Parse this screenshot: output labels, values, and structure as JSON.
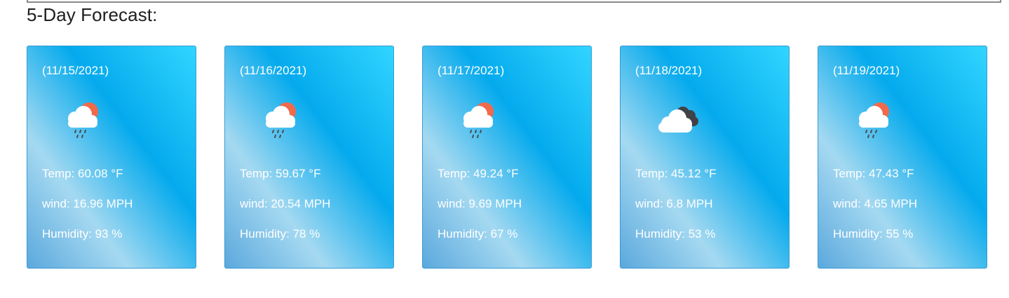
{
  "section_title": "5-Day Forecast:",
  "days": [
    {
      "date": "(11/15/2021)",
      "icon": "rain-cloud-sun-icon",
      "temp": "Temp: 60.08 °F",
      "wind": "wind: 16.96 MPH",
      "humidity": "Humidity: 93 %"
    },
    {
      "date": "(11/16/2021)",
      "icon": "rain-cloud-sun-icon",
      "temp": "Temp: 59.67 °F",
      "wind": "wind: 20.54 MPH",
      "humidity": "Humidity: 78 %"
    },
    {
      "date": "(11/17/2021)",
      "icon": "rain-cloud-sun-icon",
      "temp": "Temp: 49.24 °F",
      "wind": "wind: 9.69 MPH",
      "humidity": "Humidity: 67 %"
    },
    {
      "date": "(11/18/2021)",
      "icon": "broken-clouds-icon",
      "temp": "Temp: 45.12 °F",
      "wind": "wind: 6.8 MPH",
      "humidity": "Humidity: 53 %"
    },
    {
      "date": "(11/19/2021)",
      "icon": "rain-cloud-sun-icon",
      "temp": "Temp: 47.43 °F",
      "wind": "wind: 4.65 MPH",
      "humidity": "Humidity: 55 %"
    }
  ],
  "colors": {
    "card_gradient_start": "#32d5ff",
    "card_gradient_mid": "#04aaed",
    "card_gradient_light": "#a5d9f1",
    "card_gradient_end": "#5ba8dd",
    "sun": "#f06a4b",
    "dark_cloud": "#3f4247"
  }
}
